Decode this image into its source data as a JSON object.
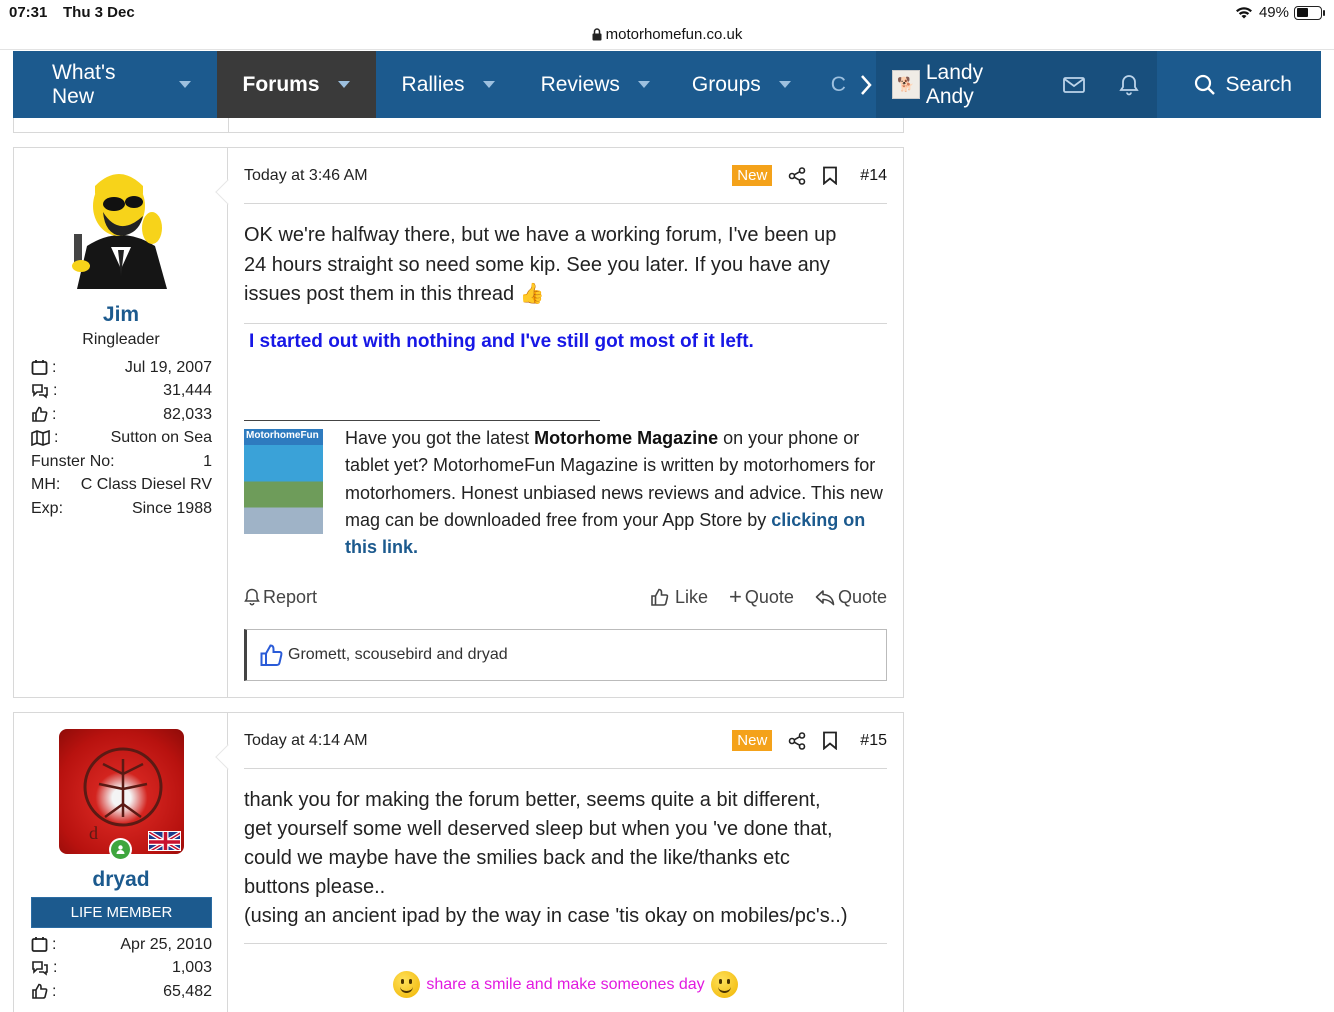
{
  "status_bar": {
    "time": "07:31",
    "date": "Thu 3 Dec",
    "battery": "49%",
    "url": "motorhomefun.co.uk"
  },
  "nav": {
    "items": [
      {
        "label": "What's New"
      },
      {
        "label": "Forums"
      },
      {
        "label": "Rallies"
      },
      {
        "label": "Reviews"
      },
      {
        "label": "Groups"
      }
    ],
    "overflow_label": "C",
    "user": "Landy Andy",
    "search": "Search"
  },
  "posts": [
    {
      "user": {
        "name": "Jim",
        "title": "Ringleader",
        "joined": "Jul 19, 2007",
        "messages": "31,444",
        "reactions": "82,033",
        "location": "Sutton on Sea",
        "extra": [
          {
            "label": "Funster No:",
            "value": "1"
          },
          {
            "label": "MH:",
            "value": "C Class Diesel RV"
          },
          {
            "label": "Exp:",
            "value": "Since 1988"
          }
        ]
      },
      "date": "Today at 3:46 AM",
      "badge": "New",
      "number": "#14",
      "body_lines": [
        "OK we're halfway there, but we have a working forum, I've been up",
        "24 hours straight so need some kip. See you later. If you have any",
        "issues post them in this thread"
      ],
      "signature": "I started out with nothing and I've still got most of it left.",
      "magazine": {
        "cover_title": "MotorhomeFun",
        "text_before": "Have you got the latest ",
        "bold": "Motorhome Magazine",
        "text_after": " on your phone or tablet yet? MotorhomeFun Magazine is written by motorhomers for motorhomers. Honest unbiased news reviews and advice. This new mag can be downloaded free from your App Store by ",
        "link": "clicking on this link."
      },
      "actions": {
        "report": "Report",
        "like": "Like",
        "multiquote": "Quote",
        "quote": "Quote"
      },
      "reactions_text": "Gromett, scousebird and dryad"
    },
    {
      "user": {
        "name": "dryad",
        "banner": "LIFE MEMBER",
        "joined": "Apr 25, 2010",
        "messages": "1,003",
        "reactions": "65,482"
      },
      "date": "Today at 4:14 AM",
      "badge": "New",
      "number": "#15",
      "body_lines": [
        "thank you for making the forum better, seems quite a bit different,",
        "get yourself some well deserved sleep but when you 've done that,",
        "could we maybe have the smilies back and the like/thanks etc",
        "buttons please..",
        "(using an ancient ipad by the way in case 'tis okay on mobiles/pc's..)"
      ],
      "signature": "share a smile and make someones day"
    }
  ],
  "colors": {
    "nav": "#1c5a8e",
    "nav_active": "#3a3a3a",
    "badge_new": "#f4a21a",
    "username": "#1c5a8e",
    "signature": "#1717e6",
    "signature2": "#e21ae0"
  }
}
